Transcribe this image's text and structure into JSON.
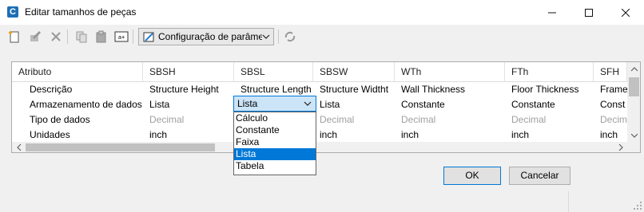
{
  "window": {
    "title": "Editar tamanhos de peças",
    "app_icon_letter": "C"
  },
  "toolbar": {
    "config_label": "Configuração de parâmetros"
  },
  "grid": {
    "header": [
      "Atributo",
      "SBSH",
      "SBSL",
      "SBSW",
      "WTh",
      "FTh",
      "SFH"
    ],
    "rows": [
      {
        "label": "Descrição",
        "cells": [
          "Structure Height",
          "Structure Length",
          "Structure Widtht",
          "Wall Thickness",
          "Floor Thickness",
          "Frame"
        ]
      },
      {
        "label": "Armazenamento de dados",
        "cells": [
          "Lista",
          "",
          "Lista",
          "Constante",
          "Constante",
          "Const"
        ]
      },
      {
        "label": "Tipo de dados",
        "cells": [
          "Decimal",
          "",
          "Decimal",
          "Decimal",
          "Decimal",
          "Decim"
        ]
      },
      {
        "label": "Unidades",
        "cells": [
          "inch",
          "",
          "inch",
          "inch",
          "inch",
          "inch"
        ]
      }
    ]
  },
  "combo": {
    "value": "Lista",
    "options": [
      "Cálculo",
      "Constante",
      "Faixa",
      "Lista",
      "Tabela"
    ],
    "selected": "Lista"
  },
  "buttons": {
    "ok": "OK",
    "cancel": "Cancelar"
  }
}
